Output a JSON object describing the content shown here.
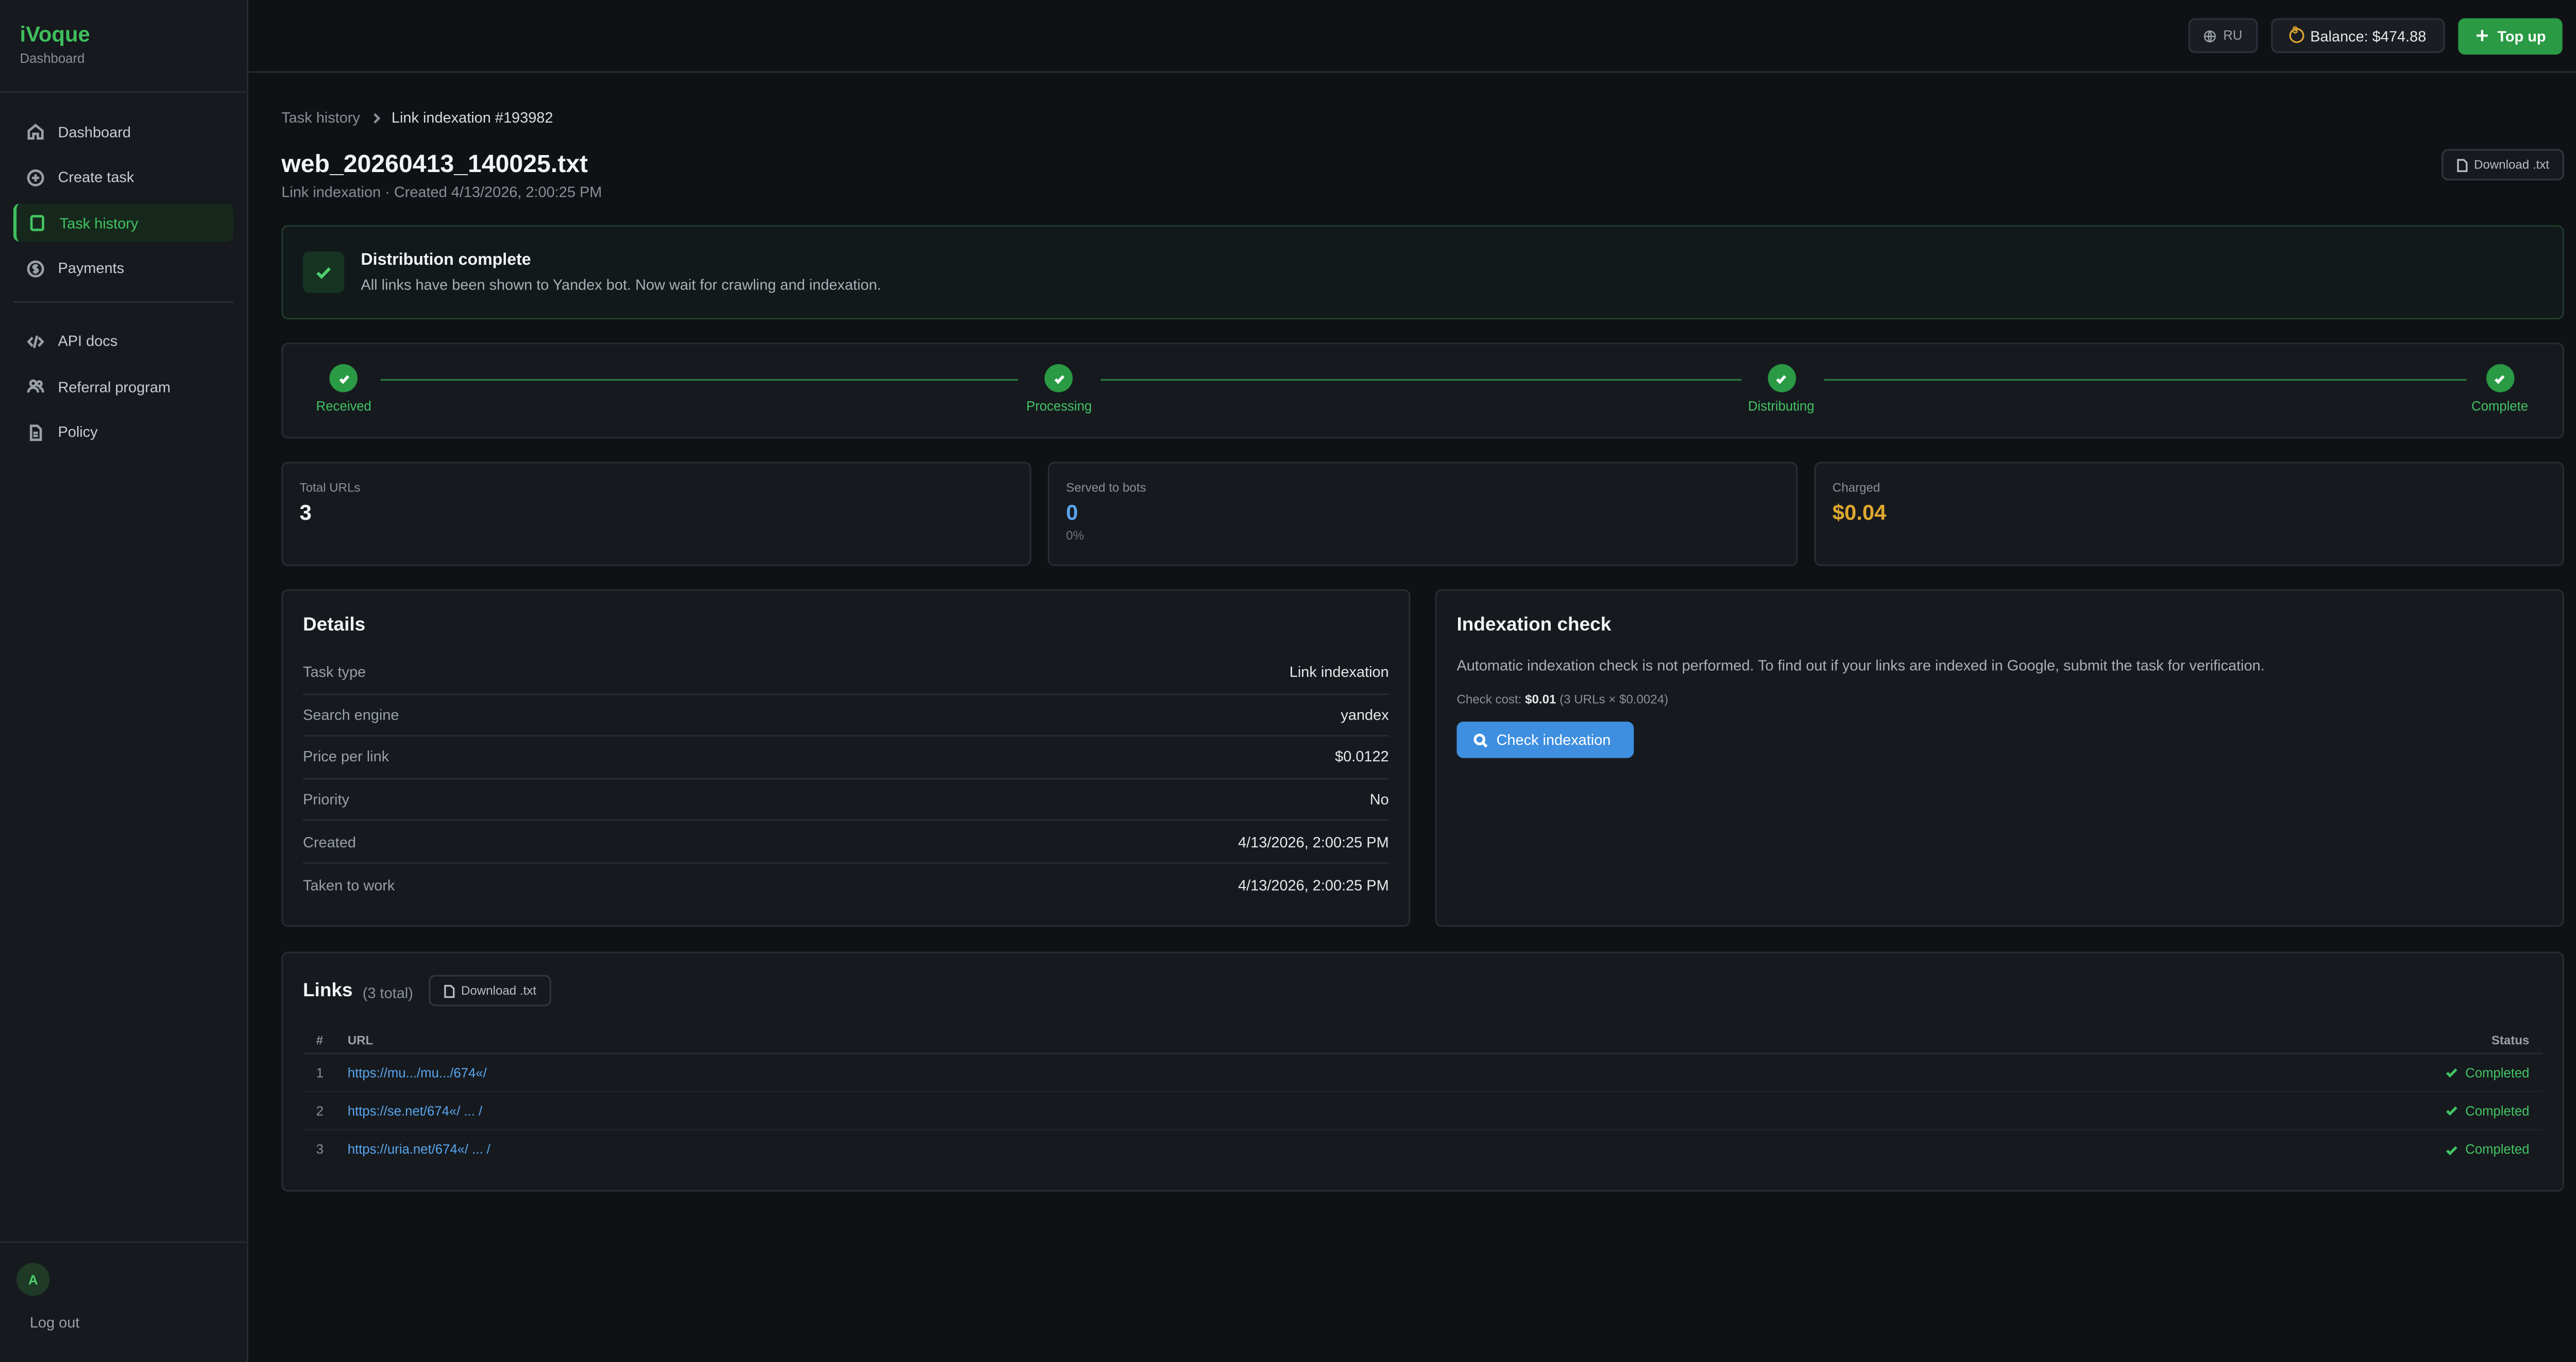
{
  "brand": {
    "name": "iVoque",
    "sub": "Dashboard"
  },
  "nav": {
    "primary": [
      {
        "label": "Dashboard",
        "icon": "home-icon"
      },
      {
        "label": "Create task",
        "icon": "plus-circle-icon"
      },
      {
        "label": "Task history",
        "icon": "clipboard-icon",
        "active": true
      },
      {
        "label": "Payments",
        "icon": "dollar-circle-icon"
      }
    ],
    "secondary": [
      {
        "label": "API docs",
        "icon": "code-icon"
      },
      {
        "label": "Referral program",
        "icon": "users-icon"
      },
      {
        "label": "Policy",
        "icon": "document-icon"
      }
    ]
  },
  "user": {
    "avatar": "A",
    "logout": "Log out"
  },
  "topbar": {
    "lang": "RU",
    "balance": "Balance: $474.88",
    "topup": "Top up"
  },
  "breadcrumb": {
    "parent": "Task history",
    "current": "Link indexation #193982"
  },
  "page": {
    "title": "web_20260413_140025.txt",
    "subtitle": "Link indexation · Created 4/13/2026, 2:00:25 PM",
    "download": "Download .txt"
  },
  "alert": {
    "title": "Distribution complete",
    "text": "All links have been shown to Yandex bot. Now wait for crawling and indexation."
  },
  "steps": [
    "Received",
    "Processing",
    "Distributing",
    "Complete"
  ],
  "stats": {
    "total": {
      "label": "Total URLs",
      "value": "3"
    },
    "served": {
      "label": "Served to bots",
      "value": "0",
      "sub": "0%"
    },
    "charged": {
      "label": "Charged",
      "value": "$0.04"
    }
  },
  "colors": {
    "accent": "#3fbf5c",
    "blue": "#5aa6ef",
    "gold": "#e0a82e"
  },
  "details": {
    "title": "Details",
    "rows": [
      {
        "key": "Task type",
        "value": "Link indexation"
      },
      {
        "key": "Search engine",
        "value": "yandex"
      },
      {
        "key": "Price per link",
        "value": "$0.0122"
      },
      {
        "key": "Priority",
        "value": "No"
      },
      {
        "key": "Created",
        "value": "4/13/2026, 2:00:25 PM"
      },
      {
        "key": "Taken to work",
        "value": "4/13/2026, 2:00:25 PM"
      }
    ]
  },
  "indexation": {
    "title": "Indexation check",
    "text": "Automatic indexation check is not performed. To find out if your links are indexed in Google, submit the task for verification.",
    "cost_label": "Check cost:",
    "cost_value": "$0.01",
    "cost_detail": "(3 URLs × $0.0024)",
    "button": "Check indexation"
  },
  "links": {
    "title": "Links",
    "count": "(3 total)",
    "download": "Download .txt",
    "headers": {
      "num": "#",
      "url": "URL",
      "status": "Status"
    },
    "rows": [
      {
        "num": "1",
        "url": "https://mu.../mu.../674«/",
        "status": "Completed"
      },
      {
        "num": "2",
        "url": "https://se.net/674«/ ... /",
        "status": "Completed"
      },
      {
        "num": "3",
        "url": "https://uria.net/674«/ ... /",
        "status": "Completed"
      }
    ]
  }
}
